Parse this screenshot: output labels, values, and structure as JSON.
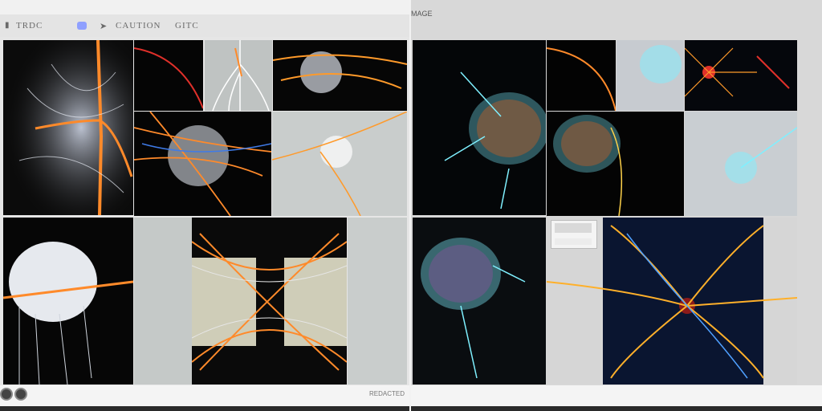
{
  "left_pane": {
    "toolbar": {
      "item1": "TRDC",
      "item2": "CAUTION",
      "item3": "GITC"
    },
    "footer_label": "REDACTED"
  },
  "right_pane": {
    "title": "MAGE"
  },
  "icons": {
    "toolbar_left": "sidebar-icon",
    "round_button": "circle-icon"
  },
  "colors": {
    "accent": "#8fa0ff",
    "dark_tile": "#0b0b0b",
    "wire_orange": "#ff8a2a",
    "wire_cyan": "#7ff0ff"
  }
}
